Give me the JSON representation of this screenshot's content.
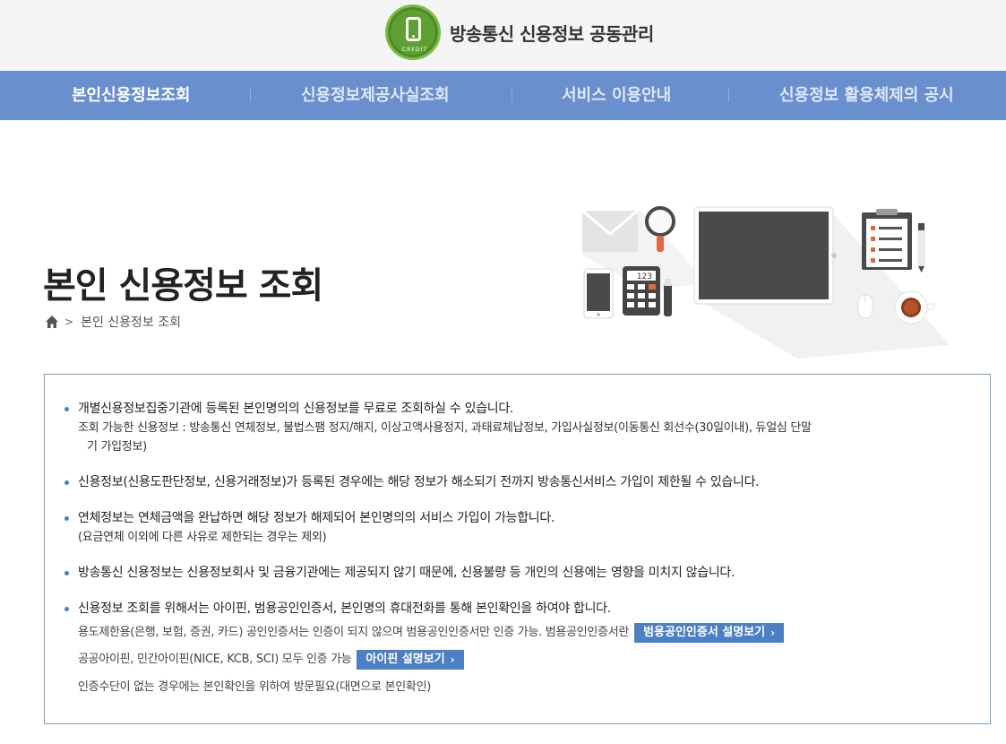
{
  "header": {
    "logo_title": "방송통신 신용정보 공동관리",
    "logo_sub": "CREDIT"
  },
  "nav": {
    "items": [
      {
        "label": "본인신용정보조회"
      },
      {
        "label": "신용정보제공사실조회"
      },
      {
        "label": "서비스 이용안내"
      },
      {
        "label": "신용정보 활용체제의 공시"
      }
    ]
  },
  "page": {
    "title": "본인 신용정보 조회",
    "breadcrumb": "본인 신용정보 조회",
    "calculator_display": "123"
  },
  "info": {
    "item1": {
      "main": "개별신용정보집중기관에 등록된 본인명의의 신용정보를 무료로 조회하실 수 있습니다.",
      "sub_line1": "조회 가능한 신용정보 : 방송통신 연체정보, 불법스팸 정지/해지, 이상고액사용정지, 과태료체납정보, 가입사실정보(이동통신 회선수(30일이내), 듀얼심 단말",
      "sub_line2": "기 가입정보)"
    },
    "item2": {
      "main": "신용정보(신용도판단정보, 신용거래정보)가 등록된 경우에는 해당 정보가 해소되기 전까지 방송통신서비스 가입이 제한될 수 있습니다."
    },
    "item3": {
      "main": "연체정보는 연체금액을 완납하면 해당 정보가 해제되어 본인명의의 서비스 가입이 가능합니다.",
      "sub": "(요금연체 이외에 다른 사유로 제한되는 경우는 제외)"
    },
    "item4": {
      "main": "방송통신 신용정보는 신용정보회사 및 금융기관에는 제공되지 않기 때문에, 신용불량 등 개인의 신용에는 영향을 미치지 않습니다."
    },
    "item5": {
      "main": "신용정보 조회를 위해서는 아이핀, 범용공인인증서, 본인명의 휴대전화를 통해 본인확인을 하여야 합니다.",
      "cert_text": "용도제한용(은행, 보험, 증권, 카드) 공인인증서는 인증이 되지 않으며 범용공인인증서만 인증 가능. 범용공인인증서란",
      "cert_button": "범용공인인증서 설명보기",
      "ipin_text": "공공아이핀, 민간아이핀(NICE, KCB, SCI) 모두 인증 가능",
      "ipin_button": "아이핀 설명보기",
      "visit_text": "인증수단이 없는 경우에는 본인확인을 위하여 방문필요(대면으로 본인확인)"
    }
  },
  "icons": {
    "logo": "phone-logo-icon",
    "home": "home-icon",
    "breadcrumb_arrow": "chevron-right-icon",
    "button_arrow": "chevron-right-icon"
  },
  "colors": {
    "nav_bg": "#6a8fce",
    "button_bg": "#4c7fc4",
    "logo_green": "#5fa032",
    "box_border": "#7aa0bd"
  }
}
